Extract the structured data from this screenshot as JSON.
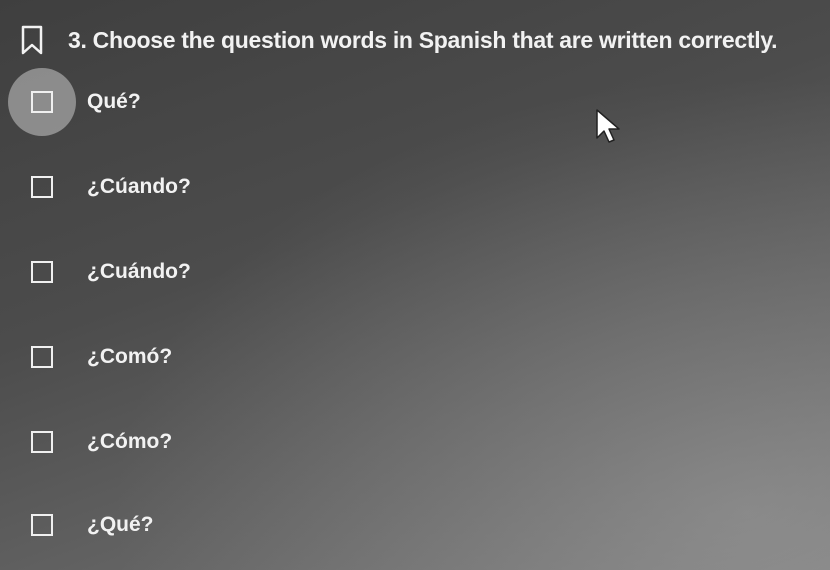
{
  "question": {
    "number_and_text": "3. Choose the question words in Spanish that are written correctly."
  },
  "options": [
    {
      "label": "Qué?"
    },
    {
      "label": "¿Cúando?"
    },
    {
      "label": "¿Cuándo?"
    },
    {
      "label": "¿Comó?"
    },
    {
      "label": "¿Cómo?"
    },
    {
      "label": "¿Qué?"
    }
  ],
  "colors": {
    "text": "#f2f2f2",
    "checkbox_border": "#f0f0f0",
    "hover_highlight": "#c8c8c8"
  }
}
